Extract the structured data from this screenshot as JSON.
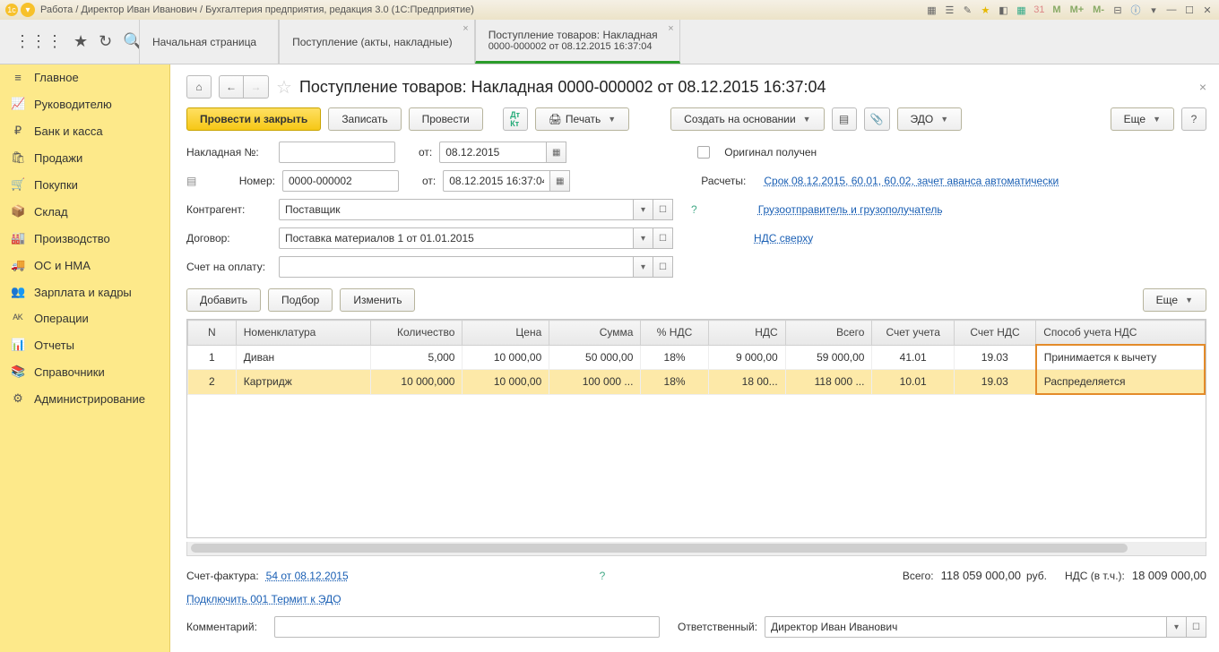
{
  "window_title": "Работа / Директор Иван Иванович / Бухгалтерия предприятия, редакция 3.0  (1С:Предприятие)",
  "m_buttons": [
    "M",
    "M+",
    "M-"
  ],
  "tabs": [
    {
      "label": "Начальная страница",
      "closable": false
    },
    {
      "label": "Поступление (акты, накладные)",
      "closable": true
    },
    {
      "label": "Поступление товаров: Накладная",
      "sub": "0000-000002 от 08.12.2015 16:37:04",
      "closable": true,
      "active": true
    }
  ],
  "sidebar": {
    "items": [
      {
        "icon": "≡",
        "label": "Главное"
      },
      {
        "icon": "📈",
        "label": "Руководителю"
      },
      {
        "icon": "₽",
        "label": "Банк и касса"
      },
      {
        "icon": "🛍",
        "label": "Продажи"
      },
      {
        "icon": "🛒",
        "label": "Покупки"
      },
      {
        "icon": "📦",
        "label": "Склад"
      },
      {
        "icon": "🏭",
        "label": "Производство"
      },
      {
        "icon": "🚚",
        "label": "ОС и НМА"
      },
      {
        "icon": "👥",
        "label": "Зарплата и кадры"
      },
      {
        "icon": "ᴬᴷ",
        "label": "Операции"
      },
      {
        "icon": "📊",
        "label": "Отчеты"
      },
      {
        "icon": "📚",
        "label": "Справочники"
      },
      {
        "icon": "⚙",
        "label": "Администрирование"
      }
    ]
  },
  "page_title": "Поступление товаров: Накладная 0000-000002 от 08.12.2015 16:37:04",
  "toolbar": {
    "post_close": "Провести и закрыть",
    "save": "Записать",
    "post": "Провести",
    "print": "Печать",
    "create_based": "Создать на основании",
    "edo": "ЭДО",
    "more": "Еще"
  },
  "form": {
    "invoice_no_lbl": "Накладная №:",
    "invoice_no": "",
    "from_lbl": "от:",
    "invoice_date": "08.12.2015",
    "original_lbl": "Оригинал получен",
    "number_lbl": "Номер:",
    "number": "0000-000002",
    "number_date": "08.12.2015 16:37:04",
    "calc_lbl": "Расчеты:",
    "calc_link": "Срок 08.12.2015, 60.01, 60.02, зачет аванса автоматически",
    "contr_lbl": "Контрагент:",
    "contr": "Поставщик",
    "shipper_link": "Грузоотправитель и грузополучатель",
    "contract_lbl": "Договор:",
    "contract": "Поставка материалов 1 от 01.01.2015",
    "vat_link": "НДС сверху",
    "bill_lbl": "Счет на оплату:",
    "bill": ""
  },
  "table_btns": {
    "add": "Добавить",
    "pick": "Подбор",
    "edit": "Изменить",
    "more": "Еще"
  },
  "table": {
    "headers": [
      "N",
      "Номенклатура",
      "Количество",
      "Цена",
      "Сумма",
      "% НДС",
      "НДС",
      "Всего",
      "Счет учета",
      "Счет НДС",
      "Способ учета НДС"
    ],
    "rows": [
      {
        "n": "1",
        "name": "Диван",
        "qty": "5,000",
        "price": "10 000,00",
        "sum": "50 000,00",
        "vatp": "18%",
        "vat": "9 000,00",
        "total": "59 000,00",
        "acc": "41.01",
        "vacc": "19.03",
        "mode": "Принимается к вычету"
      },
      {
        "n": "2",
        "name": "Картридж",
        "qty": "10 000,000",
        "price": "10 000,00",
        "sum": "100 000 ...",
        "vatp": "18%",
        "vat": "18 00...",
        "total": "118 000 ...",
        "acc": "10.01",
        "vacc": "19.03",
        "mode": "Распределяется",
        "sel": true
      }
    ]
  },
  "footer": {
    "sf_lbl": "Счет-фактура:",
    "sf_link": "54 от 08.12.2015",
    "total_lbl": "Всего:",
    "total": "118 059 000,00",
    "cur": "руб.",
    "vat_lbl": "НДС (в т.ч.):",
    "vat": "18 009 000,00",
    "edo_link": "Подключить 001 Термит к ЭДО",
    "comment_lbl": "Комментарий:",
    "comment": "",
    "resp_lbl": "Ответственный:",
    "resp": "Директор Иван Иванович"
  }
}
